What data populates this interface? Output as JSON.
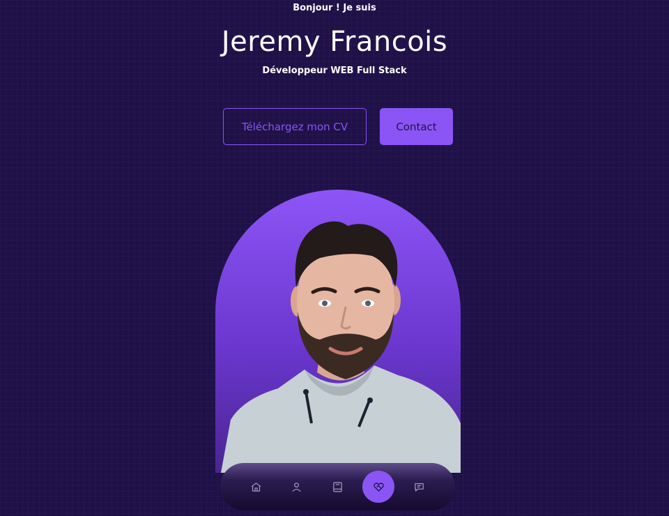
{
  "hero": {
    "greeting": "Bonjour ! Je suis",
    "name": "Jeremy Francois",
    "role": "Développeur WEB Full Stack"
  },
  "buttons": {
    "cv_label": "Téléchargez mon CV",
    "contact_label": "Contact"
  },
  "nav": {
    "items": [
      {
        "icon": "home-icon",
        "active": false
      },
      {
        "icon": "user-icon",
        "active": false
      },
      {
        "icon": "book-icon",
        "active": false
      },
      {
        "icon": "heart-handshake-icon",
        "active": true
      },
      {
        "icon": "message-icon",
        "active": false
      }
    ]
  },
  "colors": {
    "background": "#1f1148",
    "accent": "#8b55f5"
  }
}
